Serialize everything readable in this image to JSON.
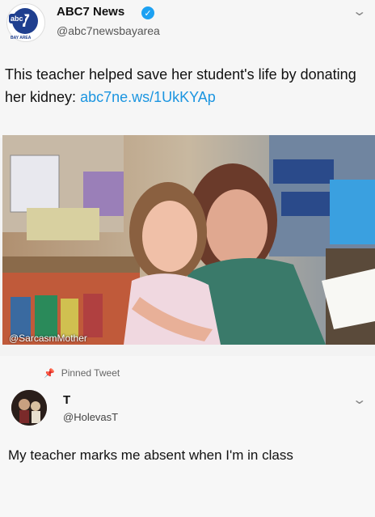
{
  "tweet": {
    "avatar_text": "7",
    "avatar_tag": "abc",
    "avatar_subtext": "BAY AREA",
    "name": "ABC7 News",
    "handle": "@abc7newsbayarea",
    "text": "This teacher helped save her student's life by donating her kidney: ",
    "link": "abc7ne.ws/1UkKYAp"
  },
  "photo": {
    "watermark": "@SarcasmMother"
  },
  "reply": {
    "pinned_label": "Pinned Tweet",
    "name": "T",
    "handle": "@HolevasT",
    "text": "My teacher marks me absent when I'm in class"
  },
  "colors": {
    "verified": "#1da1f2",
    "link": "#1b95e0",
    "abc_blue": "#1f3f8f"
  }
}
